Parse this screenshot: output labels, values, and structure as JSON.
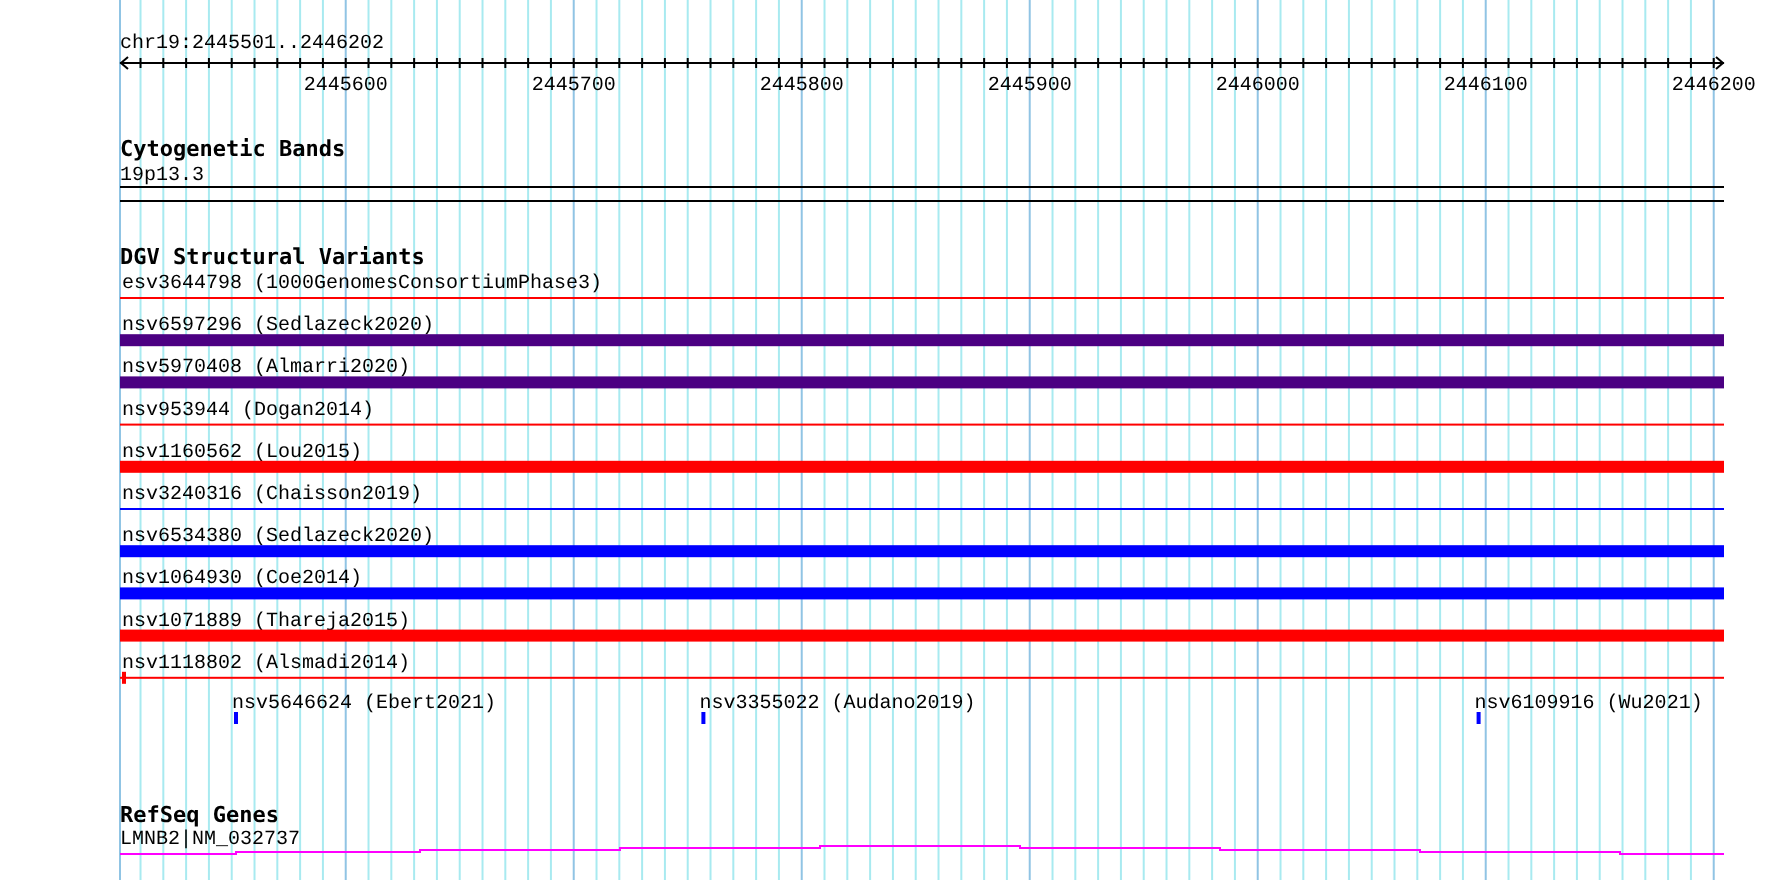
{
  "ruler": {
    "label": "chr19:2445501..2446202",
    "ticks": [
      "2445600",
      "2445700",
      "2445800",
      "2445900",
      "2446000",
      "2446100",
      "2446200"
    ]
  },
  "cytogenetic_bands": {
    "title": "Cytogenetic Bands",
    "label": "19p13.3"
  },
  "dgv_structural_variants": {
    "title": "DGV Structural Variants",
    "features": [
      {
        "label": "esv3644798 (1000GenomesConsortiumPhase3)",
        "kind": "thin",
        "color": "#ff0000"
      },
      {
        "label": "nsv6597296 (Sedlazeck2020)",
        "kind": "thick",
        "color": "#4b0082"
      },
      {
        "label": "nsv5970408 (Almarri2020)",
        "kind": "thick",
        "color": "#4b0082"
      },
      {
        "label": "nsv953944 (Dogan2014)",
        "kind": "thin",
        "color": "#ff0000"
      },
      {
        "label": "nsv1160562 (Lou2015)",
        "kind": "thick",
        "color": "#ff0000"
      },
      {
        "label": "nsv3240316 (Chaisson2019)",
        "kind": "thin",
        "color": "#0000ff"
      },
      {
        "label": "nsv6534380 (Sedlazeck2020)",
        "kind": "thick",
        "color": "#0000ff"
      },
      {
        "label": "nsv1064930 (Coe2014)",
        "kind": "thick",
        "color": "#0000ff"
      },
      {
        "label": "nsv1071889 (Thareja2015)",
        "kind": "thick",
        "color": "#ff0000"
      },
      {
        "label": "nsv1118802 (Alsmadi2014)",
        "kind": "thin-start",
        "color": "#ff0000"
      }
    ],
    "small_features": [
      {
        "label": "nsv5646624 (Ebert2021)",
        "color": "#0000ff"
      },
      {
        "label": "nsv3355022 (Audano2019)",
        "color": "#0000ff"
      },
      {
        "label": "nsv6109916 (Wu2021)",
        "color": "#0000ff"
      }
    ]
  },
  "refseq_genes": {
    "title": "RefSeq Genes",
    "label": "LMNB2|NM_032737"
  }
}
